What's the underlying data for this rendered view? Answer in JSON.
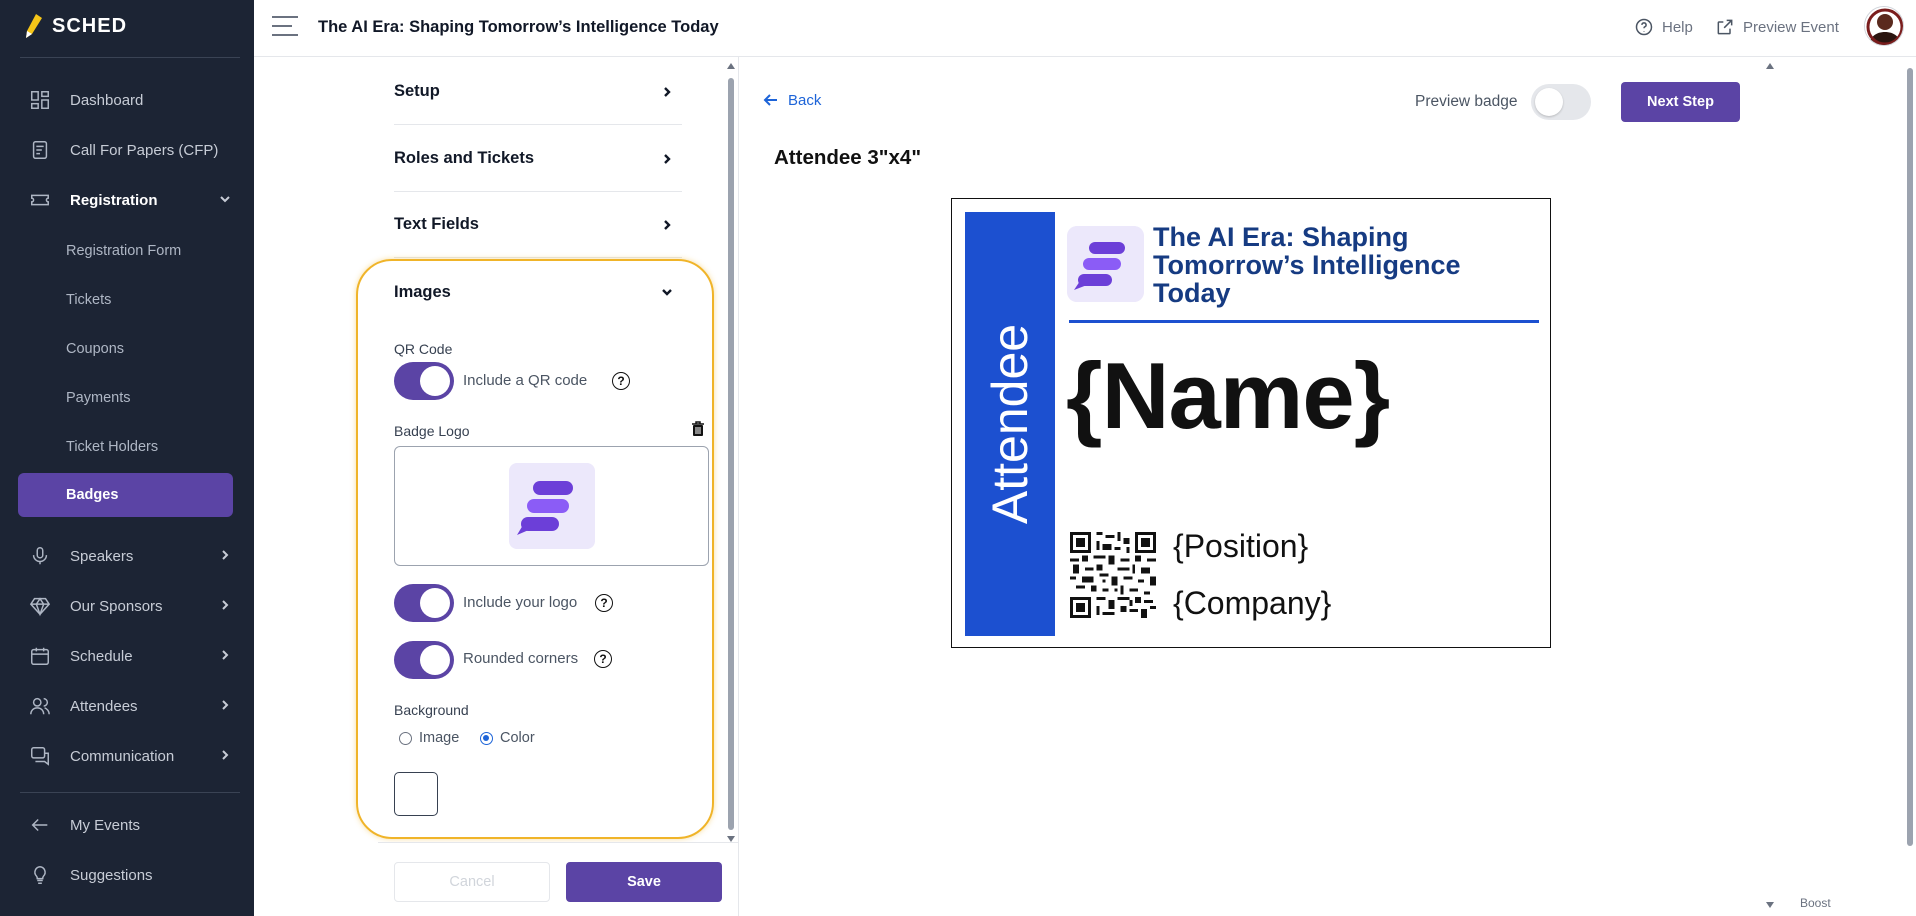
{
  "app": {
    "name": "SCHED"
  },
  "sidebar": {
    "items": [
      {
        "label": "Dashboard",
        "icon": "dashboard-icon"
      },
      {
        "label": "Call For Papers (CFP)",
        "icon": "cfp-icon"
      },
      {
        "label": "Registration",
        "icon": "ticket-icon",
        "expanded": true
      },
      {
        "label": "Speakers",
        "icon": "microphone-icon"
      },
      {
        "label": "Our Sponsors",
        "icon": "diamond-icon"
      },
      {
        "label": "Schedule",
        "icon": "calendar-icon"
      },
      {
        "label": "Attendees",
        "icon": "users-icon"
      },
      {
        "label": "Communication",
        "icon": "chat-icon"
      }
    ],
    "registration_sub": [
      "Registration Form",
      "Tickets",
      "Coupons",
      "Payments",
      "Ticket Holders",
      "Badges"
    ],
    "active_sub": "Badges",
    "footer": [
      {
        "label": "My Events",
        "icon": "arrow-left-icon"
      },
      {
        "label": "Suggestions",
        "icon": "lightbulb-icon"
      }
    ]
  },
  "topbar": {
    "event_title": "The AI Era: Shaping Tomorrow’s Intelligence Today",
    "help": "Help",
    "preview_event": "Preview Event"
  },
  "config": {
    "sections": [
      "Setup",
      "Roles and Tickets",
      "Text Fields",
      "Images"
    ],
    "images": {
      "qr_label": "QR Code",
      "qr_toggle": "Include a QR code",
      "qr_on": true,
      "logo_label": "Badge Logo",
      "include_logo": "Include your logo",
      "include_logo_on": true,
      "rounded": "Rounded corners",
      "rounded_on": true,
      "background_label": "Background",
      "bg_options": [
        "Image",
        "Color"
      ],
      "bg_selected": "Color",
      "color_value": "#ffffff"
    },
    "cancel": "Cancel",
    "save": "Save"
  },
  "preview": {
    "back": "Back",
    "preview_badge": "Preview badge",
    "preview_badge_on": false,
    "next_step": "Next Step",
    "badge_size": "Attendee 3\"x4\"",
    "badge": {
      "role": "Attendee",
      "event": "The AI Era: Shaping Tomorrow’s Intelligence Today",
      "name": "{Name}",
      "position": "{Position}",
      "company": "{Company}",
      "accent": "#1c50d0"
    }
  },
  "footer_widget": "Boost",
  "colors": {
    "sidebar": "#1c2434",
    "primary": "#5b44a5",
    "link": "#1d64d8",
    "highlight": "#f0b429"
  }
}
